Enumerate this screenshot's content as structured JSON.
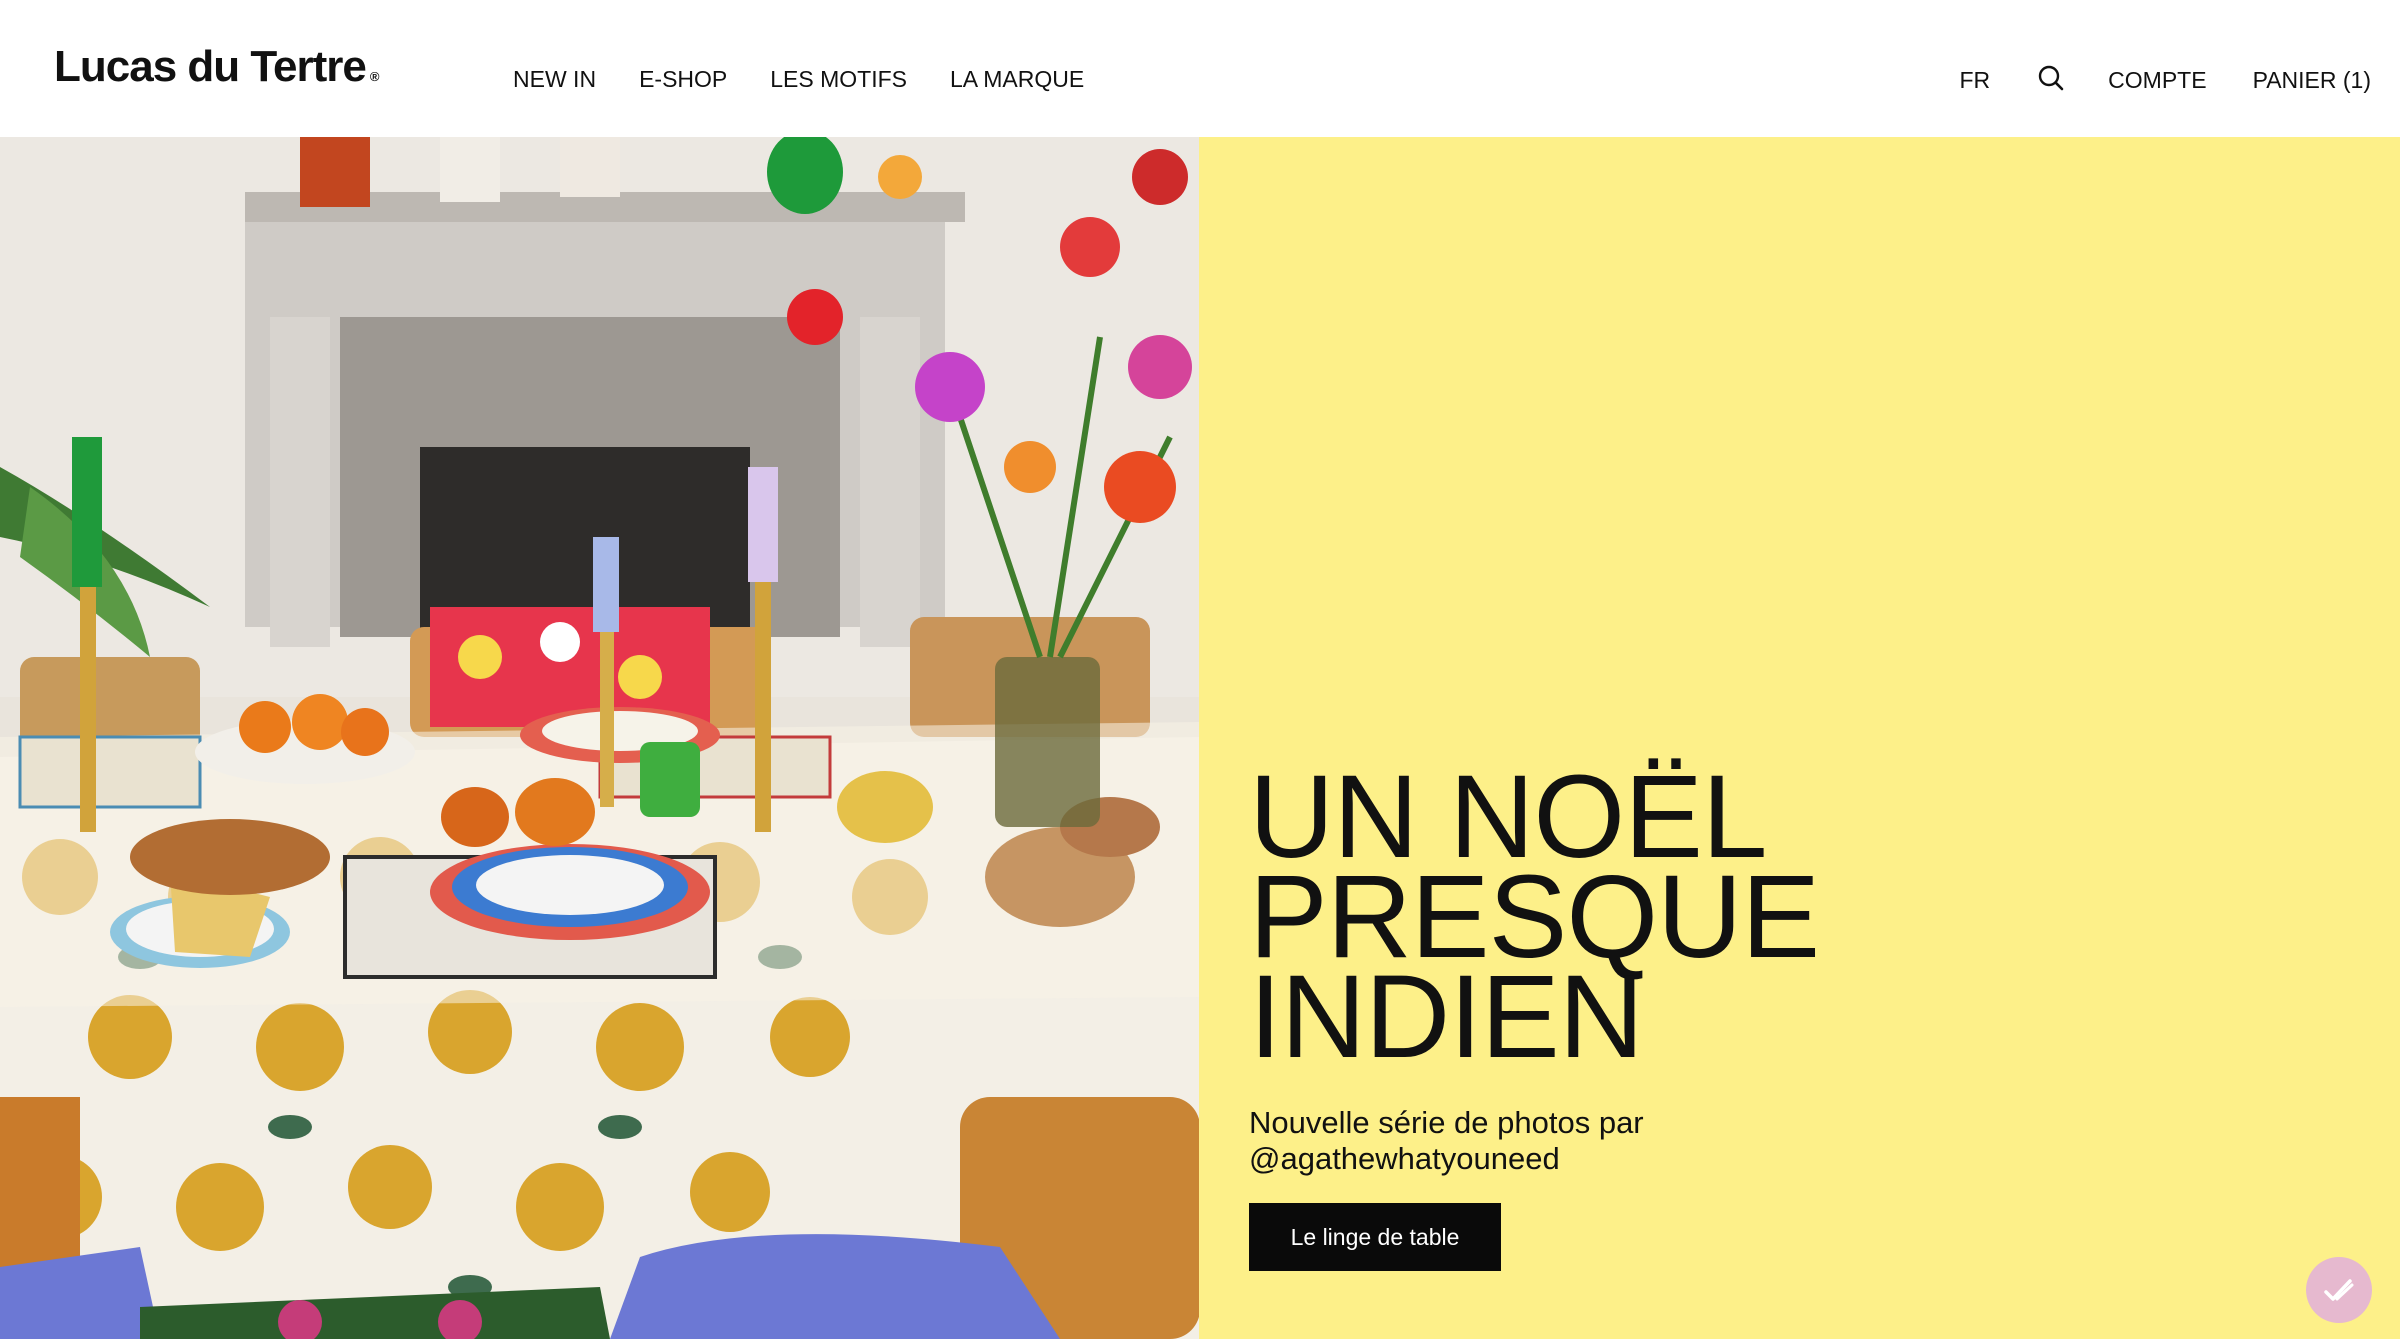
{
  "brand": {
    "logo_text": "Lucas du Tertre",
    "logo_mark": "®"
  },
  "nav": {
    "items": [
      {
        "label": "NEW IN"
      },
      {
        "label": "E-SHOP"
      },
      {
        "label": "LES MOTIFS"
      },
      {
        "label": "LA MARQUE"
      }
    ]
  },
  "utility_nav": {
    "language": "FR",
    "search_icon": "search-icon",
    "account": "COMPTE",
    "cart": "PANIER (1)"
  },
  "hero": {
    "headline_lines": [
      "UN NOËL",
      "PRESQUE",
      "INDIEN"
    ],
    "subtitle_line1": "Nouvelle série de photos par",
    "subtitle_line2": "@agathewhatyouneed",
    "cta_label": "Le linge de table",
    "image_icon": "table-setting-photo",
    "panel_color": "#fdf089"
  },
  "chat": {
    "icon": "chat-check-icon",
    "color": "#e6b9cf"
  }
}
